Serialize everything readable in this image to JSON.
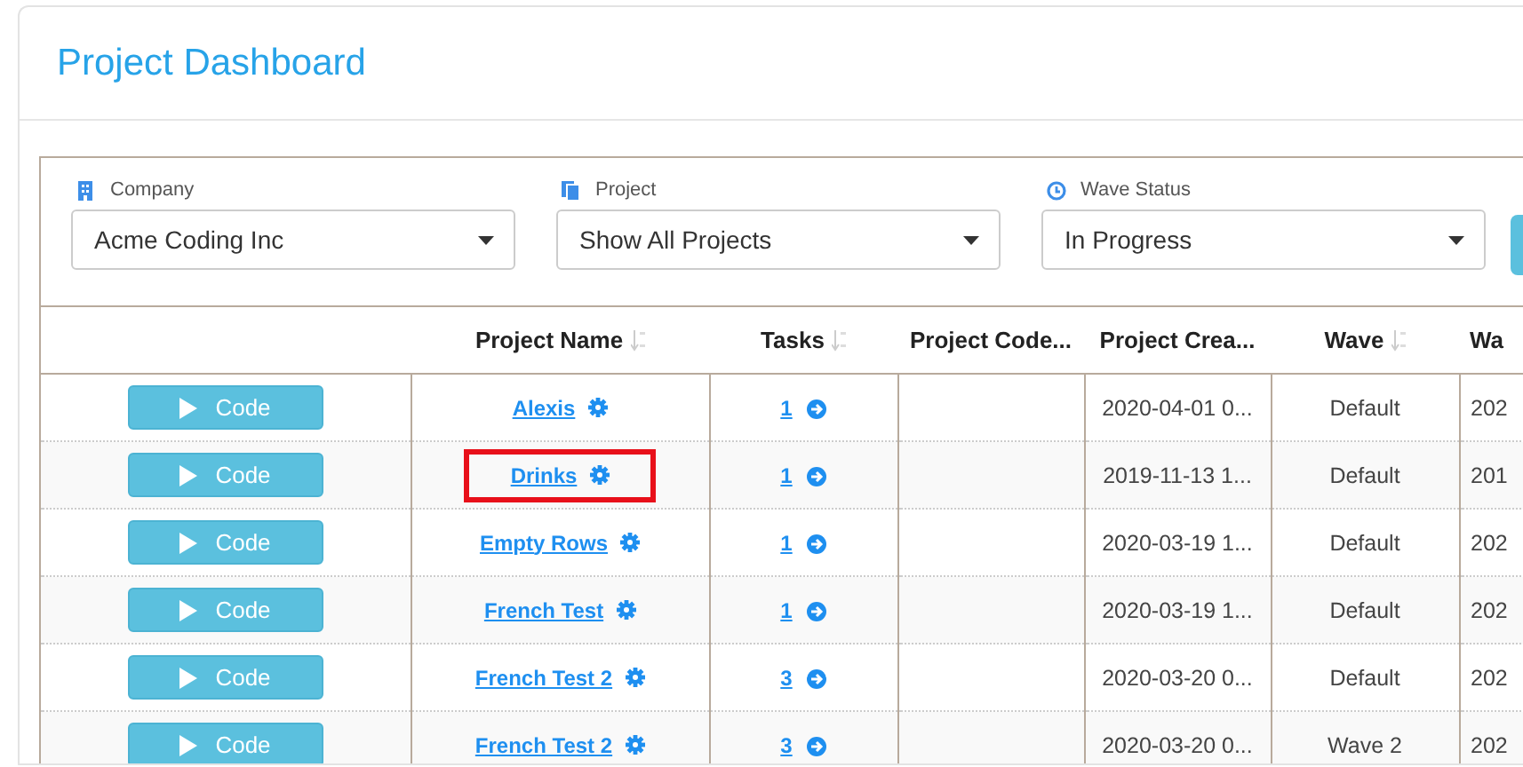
{
  "page": {
    "title": "Project Dashboard"
  },
  "filters": [
    {
      "label": "Company",
      "value": "Acme Coding Inc"
    },
    {
      "label": "Project",
      "value": "Show All Projects"
    },
    {
      "label": "Wave Status",
      "value": "In Progress"
    }
  ],
  "table": {
    "columns": [
      {},
      {
        "label": "Project Name",
        "sortable": true
      },
      {
        "label": "Tasks",
        "sortable": true
      },
      {
        "label": "Project Code...",
        "sortable": false
      },
      {
        "label": "Project Crea...",
        "sortable": false
      },
      {
        "label": "Wave",
        "sortable": true
      },
      {
        "label": "Wa",
        "sortable": false
      }
    ],
    "rows": [
      {
        "button": "Code",
        "name": "Alexis",
        "tasks": "1",
        "created": "2020-04-01 0...",
        "wave": "Default",
        "column_7": "202",
        "highlighted": false
      },
      {
        "button": "Code",
        "name": "Drinks",
        "tasks": "1",
        "created": "2019-11-13 1...",
        "wave": "Default",
        "column_7": "201",
        "highlighted": true
      },
      {
        "button": "Code",
        "name": "Empty Rows",
        "tasks": "1",
        "created": "2020-03-19 1...",
        "wave": "Default",
        "column_7": "202",
        "highlighted": false
      },
      {
        "button": "Code",
        "name": "French Test",
        "tasks": "1",
        "created": "2020-03-19 1...",
        "wave": "Default",
        "column_7": "202",
        "highlighted": false
      },
      {
        "button": "Code",
        "name": "French Test 2",
        "tasks": "3",
        "created": "2020-03-20 0...",
        "wave": "Default",
        "column_7": "202",
        "highlighted": false
      },
      {
        "button": "Code",
        "name": "French Test 2",
        "tasks": "3",
        "created": "2020-03-20 0...",
        "wave": "Wave 2",
        "column_7": "202",
        "highlighted": false
      }
    ]
  }
}
